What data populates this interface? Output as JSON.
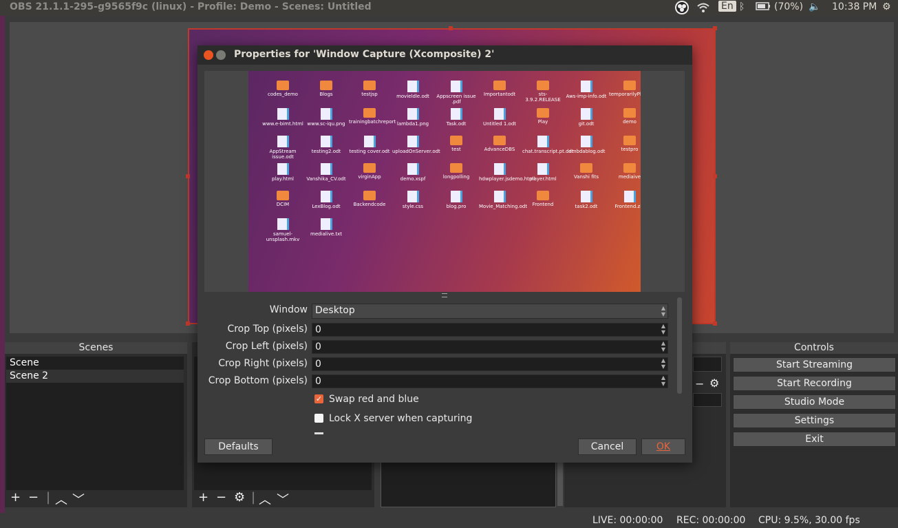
{
  "topbar": {
    "title": "OBS 21.1.1-295-g9565f9c (linux) - Profile: Demo - Scenes: Untitled",
    "keyboard": "En",
    "battery": "(70%)",
    "time": "10:38 PM"
  },
  "dialog": {
    "title": "Properties for 'Window Capture (Xcomposite) 2'",
    "desktop_icons": [
      "codes_demo",
      "Blogs",
      "testjsp",
      "movieldle.odt",
      "Appscreen issue .pdf",
      "Importantodt",
      "sts-3.9.2.RELEASE",
      "Aws-imp-info.odt",
      "temporarilyPlayingStream",
      "www.e-bimt.html",
      "www.sc-iqu.png",
      "trainingbatchreport",
      "lambda1.png",
      "Task.odt",
      "Untitled 1.odt",
      "Play",
      "git.odt",
      "demo",
      "AppStream issue.odt",
      "testing2.odt",
      "testing cover.odt",
      "uploadOnServer.odt",
      "test",
      "AdvanceDBS",
      "chat.transcript.pt.odt",
      "lambdablog.odt",
      "testpro",
      "play.html",
      "Vanshika_CV.odt",
      "virginApp",
      "demo.xspf",
      "longpolling",
      "hdwplayer.jsdemo.html",
      "player.html",
      "Vanshi fits",
      "mediaive",
      "DCIM",
      "LexBlog.odt",
      "Backendcode",
      "style.css",
      "blog.pro",
      "Movie_Matching.odt",
      "Frontend",
      "task2.odt",
      "Frontend.zip",
      "samuel-unsplash.mkv",
      "medialive.txt"
    ],
    "fields": {
      "window_label": "Window",
      "window_value": "Desktop",
      "crop_top_label": "Crop Top (pixels)",
      "crop_top_value": "0",
      "crop_left_label": "Crop Left (pixels)",
      "crop_left_value": "0",
      "crop_right_label": "Crop Right (pixels)",
      "crop_right_value": "0",
      "crop_bottom_label": "Crop Bottom (pixels)",
      "crop_bottom_value": "0",
      "swap_label": "Swap red and blue",
      "swap_checked": true,
      "lock_label": "Lock X server when capturing",
      "lock_checked": false
    },
    "buttons": {
      "defaults": "Defaults",
      "cancel": "Cancel",
      "ok": "OK"
    }
  },
  "scenes": {
    "header": "Scenes",
    "items": [
      "Scene",
      "Scene 2"
    ]
  },
  "controls": {
    "header": "Controls",
    "start_streaming": "Start Streaming",
    "start_recording": "Start Recording",
    "studio_mode": "Studio Mode",
    "settings": "Settings",
    "exit": "Exit"
  },
  "status": {
    "live": "LIVE: 00:00:00",
    "rec": "REC: 00:00:00",
    "cpu": "CPU: 9.5%, 30.00 fps"
  },
  "colors": {
    "accent_red": "#c0392b",
    "checkbox_orange": "#e9653b",
    "close_button": "#e95420"
  }
}
